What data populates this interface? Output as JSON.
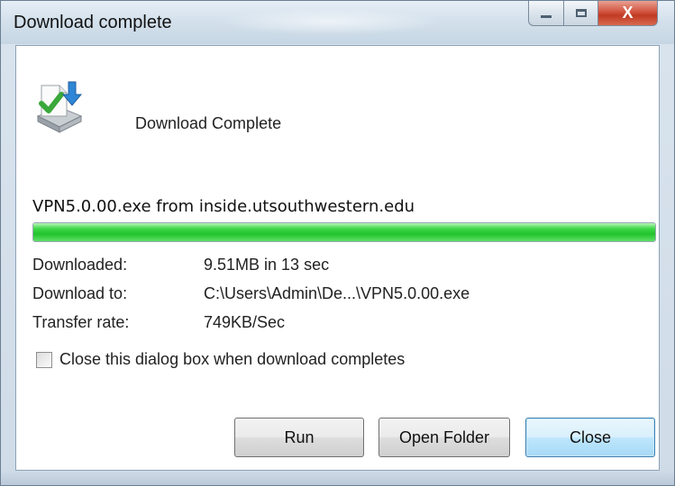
{
  "window": {
    "title": "Download complete"
  },
  "caption_buttons": {
    "minimize_icon": "minimize-icon",
    "maximize_icon": "maximize-icon",
    "close_label": "X"
  },
  "content": {
    "icon": "download-complete-icon",
    "heading": "Download Complete",
    "file_source": "VPN5.0.00.exe from inside.utsouthwestern.edu",
    "progress_fraction": 1.0,
    "progress_color": "#22c22c"
  },
  "details": [
    {
      "label": "Downloaded:",
      "value": "9.51MB in 13 sec"
    },
    {
      "label": "Download to:",
      "value": "C:\\Users\\Admin\\De...\\VPN5.0.00.exe"
    },
    {
      "label": "Transfer rate:",
      "value": "749KB/Sec"
    }
  ],
  "options": {
    "close_when_done_label": "Close this dialog box when download completes",
    "close_when_done_checked": false
  },
  "buttons": {
    "run": "Run",
    "open_folder": "Open Folder",
    "close": "Close"
  }
}
